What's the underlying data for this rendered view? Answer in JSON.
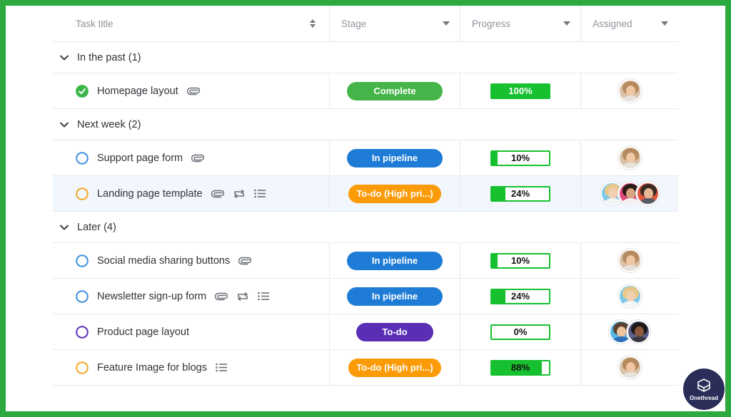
{
  "columns": {
    "task": "Task title",
    "stage": "Stage",
    "progress": "Progress",
    "assigned": "Assigned"
  },
  "groups": [
    {
      "label": "In the past (1)",
      "tasks": [
        {
          "title": "Homepage layout",
          "status": "done",
          "icons": [
            "attachment-icon"
          ],
          "stage": "Complete",
          "stage_color": "#45b549",
          "progress": "100%",
          "progress_value": 100,
          "assignees": [
            "woman-glasses"
          ]
        }
      ]
    },
    {
      "label": "Next week (2)",
      "tasks": [
        {
          "title": "Support page form",
          "status": "pipeline",
          "icons": [
            "attachment-icon"
          ],
          "stage": "In pipeline",
          "stage_color": "#1e7cd6",
          "progress": "10%",
          "progress_value": 10,
          "assignees": [
            "woman-glasses"
          ]
        },
        {
          "title": "Landing page template",
          "status": "todo-high",
          "icons": [
            "attachment-icon",
            "recurring-icon",
            "checklist-icon"
          ],
          "stage": "To-do (High pri...)",
          "stage_color": "#fb9b08",
          "progress": "24%",
          "progress_value": 24,
          "assignees": [
            "woman-blonde",
            "woman-dark",
            "man-red"
          ]
        }
      ]
    },
    {
      "label": "Later (4)",
      "tasks": [
        {
          "title": "Social media sharing buttons",
          "status": "pipeline",
          "icons": [
            "attachment-icon"
          ],
          "stage": "In pipeline",
          "stage_color": "#1e7cd6",
          "progress": "10%",
          "progress_value": 10,
          "assignees": [
            "woman-glasses"
          ]
        },
        {
          "title": "Newsletter sign-up form",
          "status": "pipeline",
          "icons": [
            "attachment-icon",
            "recurring-icon",
            "checklist-icon"
          ],
          "stage": "In pipeline",
          "stage_color": "#1e7cd6",
          "progress": "24%",
          "progress_value": 24,
          "assignees": [
            "woman-blonde"
          ]
        },
        {
          "title": "Product page layout",
          "status": "todo",
          "icons": [],
          "stage": "To-do",
          "stage_color": "#5a2fb6",
          "progress": "0%",
          "progress_value": 0,
          "assignees": [
            "man-blue",
            "man-dark"
          ]
        },
        {
          "title": "Feature Image for blogs",
          "status": "todo-high",
          "icons": [
            "checklist-icon"
          ],
          "stage": "To-do (High pri...)",
          "stage_color": "#fb9b08",
          "progress": "88%",
          "progress_value": 88,
          "assignees": [
            "woman-glasses"
          ]
        }
      ]
    }
  ],
  "colors": {
    "border": "#2daa3f",
    "progress_green": "#17c02e",
    "pipeline_circle": "#3b8fe0",
    "todo_high_circle": "#f6a623",
    "todo_circle": "#5a2fb6",
    "done_check": "#3bb54a"
  },
  "brand": {
    "name": "Onethread"
  }
}
